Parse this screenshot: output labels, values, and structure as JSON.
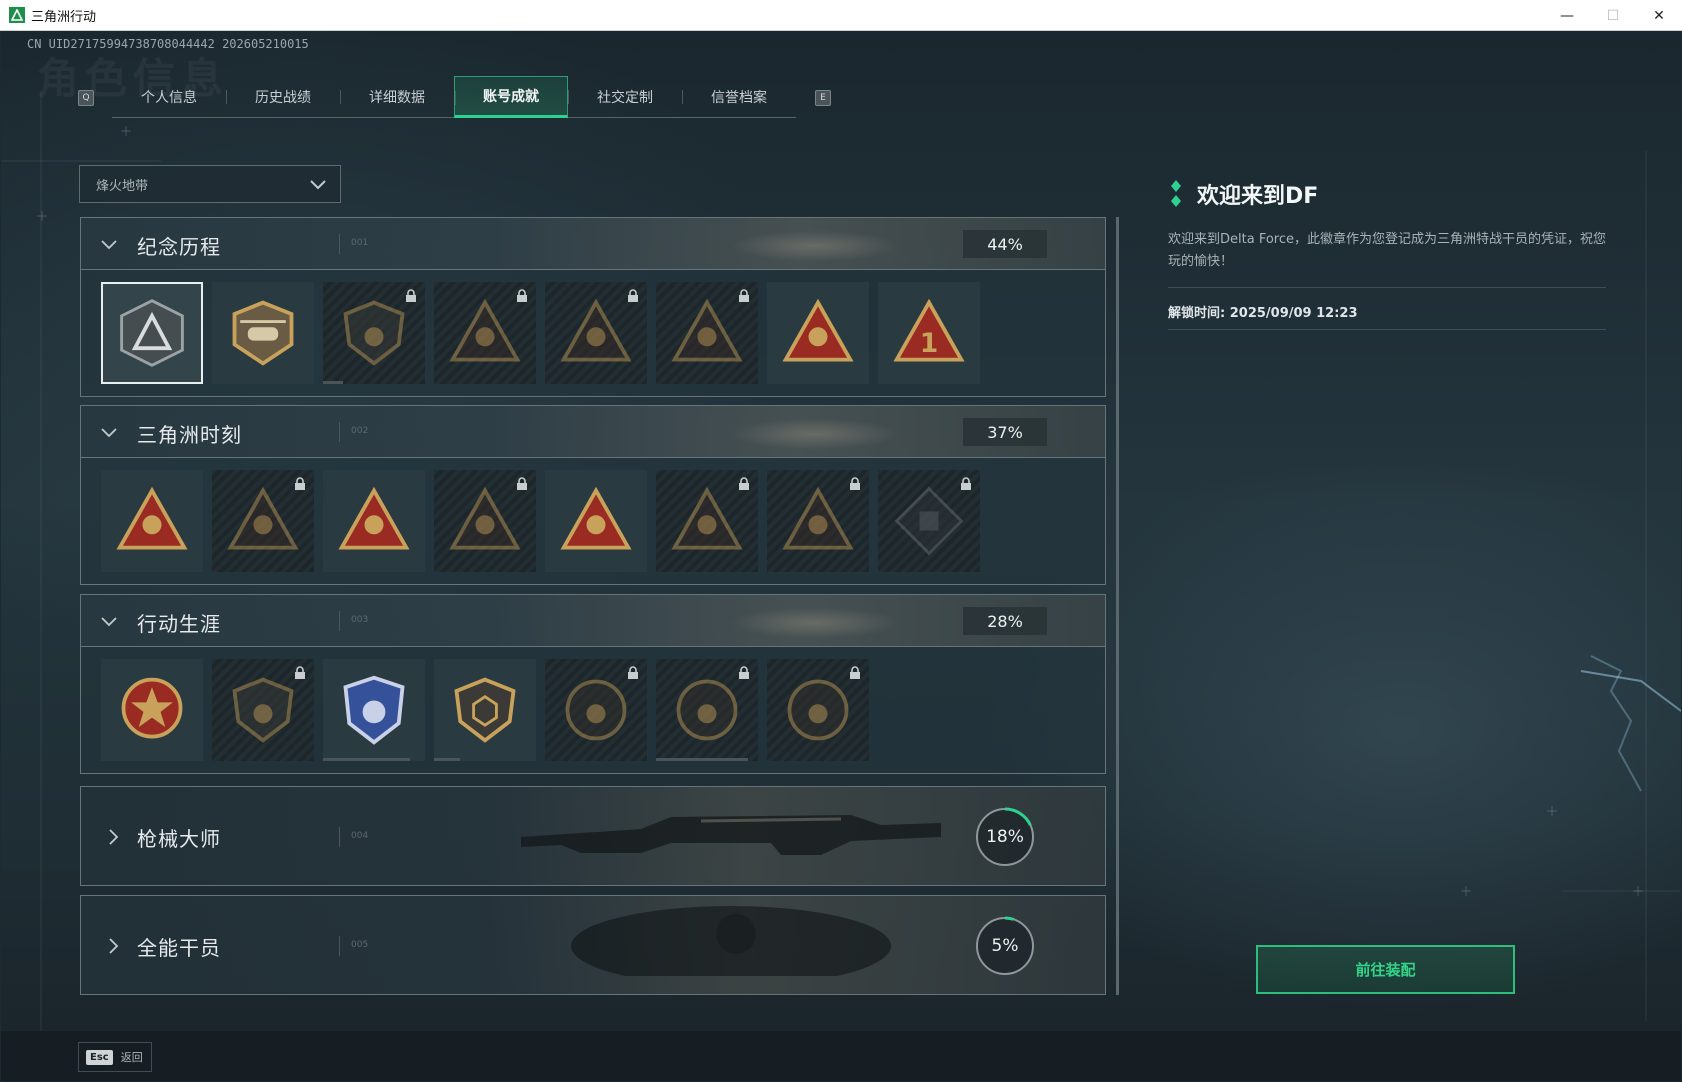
{
  "window": {
    "title": "三角洲行动",
    "minimize": "—",
    "maximize": "☐",
    "close": "✕"
  },
  "uid": "CN UID27175994738708044442 202605210015",
  "watermark": "角色信息",
  "tabs": {
    "left_key": "Q",
    "right_key": "E",
    "items": [
      "个人信息",
      "历史战绩",
      "详细数据",
      "账号成就",
      "社交定制",
      "信誉档案"
    ],
    "active_index": 3
  },
  "mode_select": {
    "value": "烽火地带"
  },
  "categories": [
    {
      "name": "纪念历程",
      "code": "001",
      "percent": "44%",
      "expanded": true,
      "badges": [
        {
          "icon": "delta-triangle-icon",
          "locked": false,
          "selected": true
        },
        {
          "icon": "helicopter-icon",
          "locked": false
        },
        {
          "icon": "shield-emblem-icon",
          "locked": true,
          "progress": 0.2
        },
        {
          "icon": "soldier-emblem-icon",
          "locked": true
        },
        {
          "icon": "hooded-figure-icon",
          "locked": true
        },
        {
          "icon": "crossed-swords-icon",
          "locked": true
        },
        {
          "icon": "crossed-hands-icon",
          "locked": false
        },
        {
          "icon": "number-one-icon",
          "locked": false
        }
      ]
    },
    {
      "name": "三角洲时刻",
      "code": "002",
      "percent": "37%",
      "expanded": true,
      "badges": [
        {
          "icon": "supply-drop-icon",
          "locked": false
        },
        {
          "icon": "bear-emblem-icon",
          "locked": true
        },
        {
          "icon": "kneeling-figure-icon",
          "locked": false
        },
        {
          "icon": "dice-hands-icon",
          "locked": true
        },
        {
          "icon": "team-figures-icon",
          "locked": false
        },
        {
          "icon": "wolf-emblem-icon",
          "locked": true
        },
        {
          "icon": "dragon-emblem-icon",
          "locked": true
        },
        {
          "icon": "cube-diamond-icon",
          "locked": true
        }
      ]
    },
    {
      "name": "行动生涯",
      "code": "003",
      "percent": "28%",
      "expanded": true,
      "badges": [
        {
          "icon": "star-medal-icon",
          "locked": false
        },
        {
          "icon": "chevron-shield-icon",
          "locked": true
        },
        {
          "icon": "blue-eagle-shield-icon",
          "locked": false,
          "progress": 0.85
        },
        {
          "icon": "hex-badge-icon",
          "locked": false,
          "progress": 0.25
        },
        {
          "icon": "coin-emblem-icon",
          "locked": true
        },
        {
          "icon": "skull-crosshair-icon",
          "locked": true,
          "progress": 0.9
        },
        {
          "icon": "eye-emblem-icon",
          "locked": true
        }
      ]
    },
    {
      "name": "枪械大师",
      "code": "004",
      "percent": "18%",
      "percent_value": 18,
      "expanded": false
    },
    {
      "name": "全能干员",
      "code": "005",
      "percent": "5%",
      "percent_value": 5,
      "expanded": false
    }
  ],
  "info": {
    "title": "欢迎来到DF",
    "description": "欢迎来到Delta Force，此徽章作为您登记成为三角洲特战干员的凭证，祝您玩的愉快！",
    "unlock_time": "解锁时间: 2025/09/09 12:23"
  },
  "go_button": "前往装配",
  "bottom": {
    "esc_key": "Esc",
    "esc_label": "返回"
  },
  "colors": {
    "accent": "#2ed190",
    "badge_gold": "#c8a25a",
    "badge_red": "#9a2b23"
  }
}
